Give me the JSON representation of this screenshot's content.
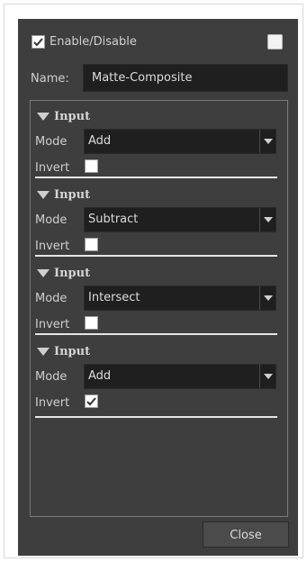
{
  "header": {
    "enable_label": "Enable/Disable",
    "enable_checked": true,
    "extra_checkbox_checked": false
  },
  "name": {
    "label": "Name:",
    "value": "Matte-Composite"
  },
  "inputs": [
    {
      "title": "Input",
      "mode_label": "Mode",
      "mode_value": "Add",
      "invert_label": "Invert",
      "invert_checked": false
    },
    {
      "title": "Input",
      "mode_label": "Mode",
      "mode_value": "Subtract",
      "invert_label": "Invert",
      "invert_checked": false
    },
    {
      "title": "Input",
      "mode_label": "Mode",
      "mode_value": "Intersect",
      "invert_label": "Invert",
      "invert_checked": false
    },
    {
      "title": "Input",
      "mode_label": "Mode",
      "mode_value": "Add",
      "invert_label": "Invert",
      "invert_checked": true
    }
  ],
  "footer": {
    "close_label": "Close"
  },
  "colors": {
    "dialog_bg": "#3e3e3e",
    "field_bg": "#1f1f1f",
    "text": "#d2d2d2"
  },
  "icons": {
    "collapse": "triangle-down-icon",
    "dropdown": "chevron-down-icon",
    "check": "checkmark-icon"
  }
}
